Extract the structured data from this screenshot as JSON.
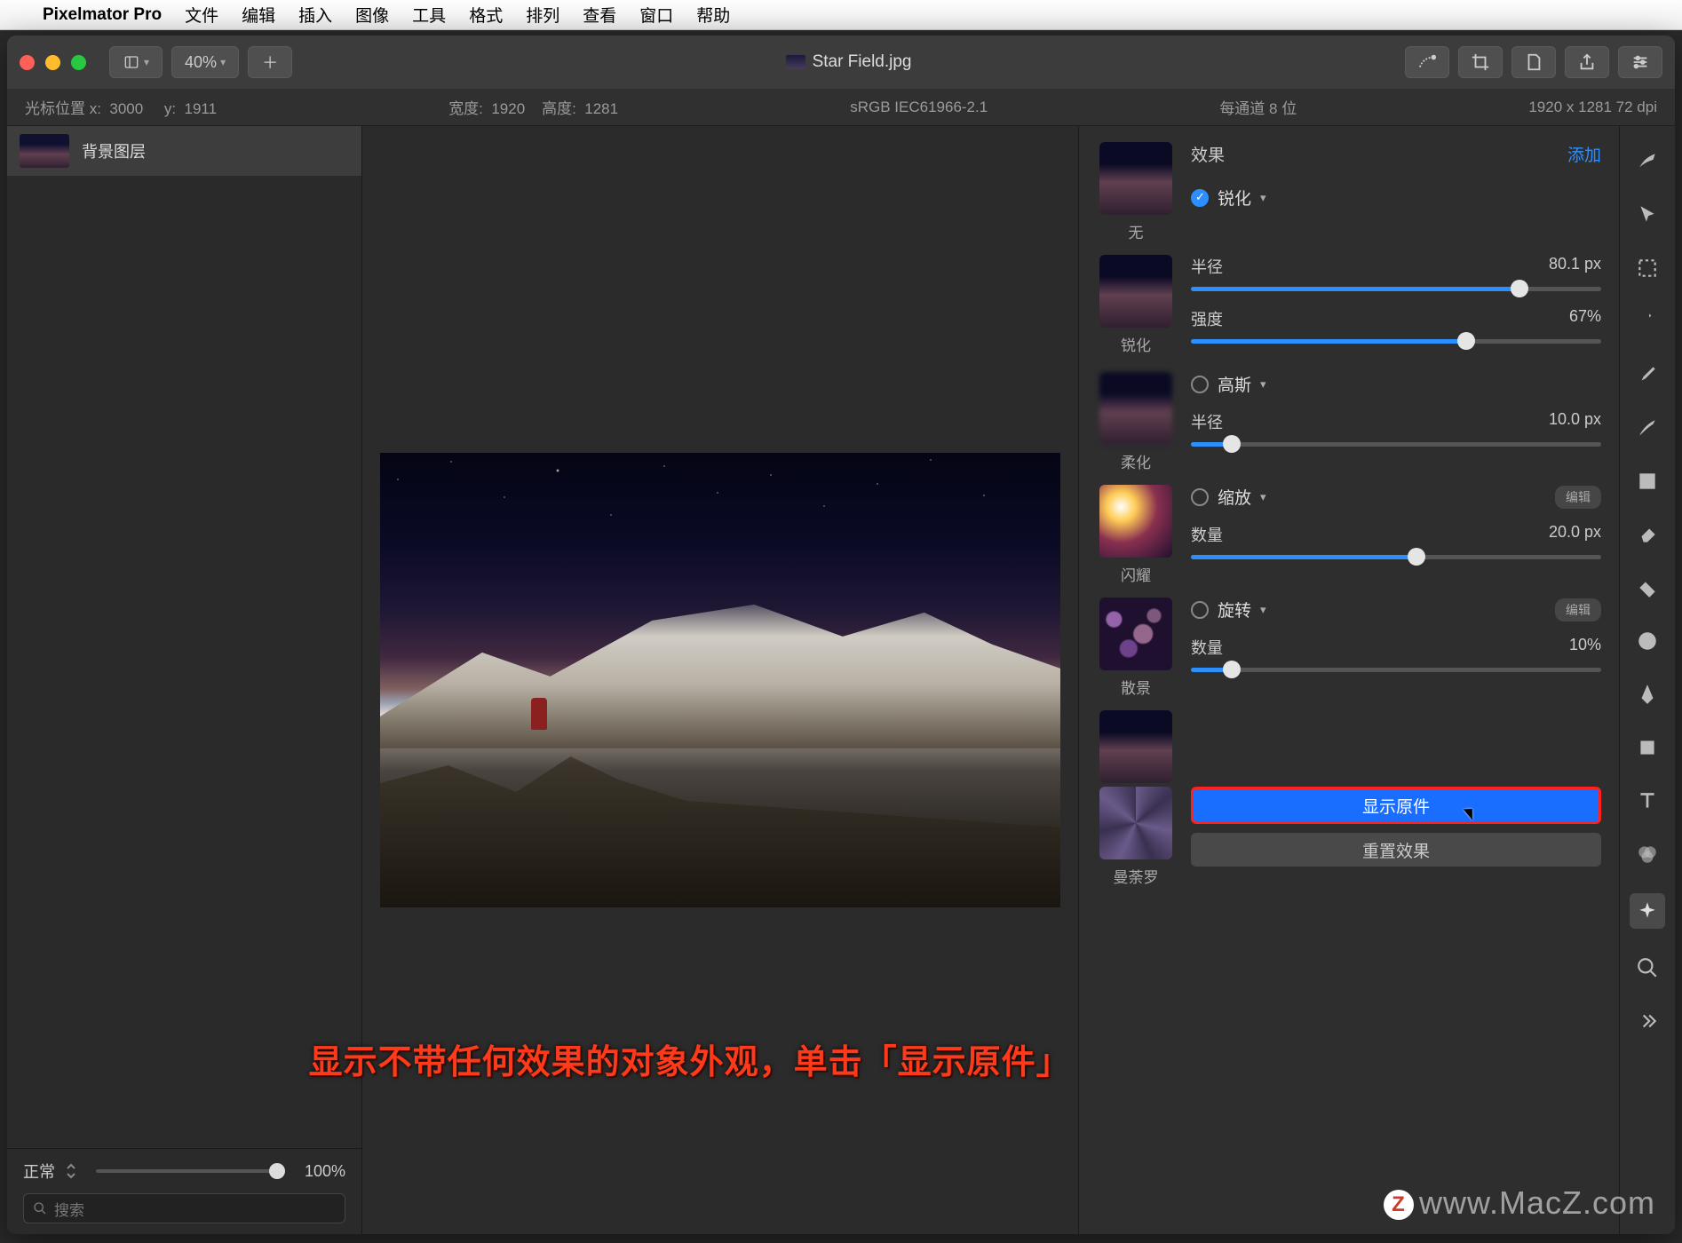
{
  "menubar": {
    "app": "Pixelmator Pro",
    "items": [
      "文件",
      "编辑",
      "插入",
      "图像",
      "工具",
      "格式",
      "排列",
      "查看",
      "窗口",
      "帮助"
    ]
  },
  "toolbar": {
    "zoom": "40%",
    "filename": "Star Field.jpg"
  },
  "infobar": {
    "cursor_label": "光标位置 x:  3000     y:  1911",
    "width": "宽度:  1920",
    "height": "高度:  1281",
    "profile": "sRGB IEC61966-2.1",
    "depth": "每通道 8 位",
    "dims": "1920 x 1281 72 dpi"
  },
  "layers": {
    "item0": "背景图层",
    "blend_mode": "正常",
    "opacity": "100%",
    "search_placeholder": "搜索"
  },
  "effects": {
    "title": "效果",
    "add": "添加",
    "presets": {
      "none": "无",
      "sharpen": "锐化",
      "soften": "柔化",
      "flash": "闪耀",
      "bokeh": "散景",
      "kaleido": "曼荼罗"
    },
    "sharpen": {
      "name": "锐化",
      "radius_label": "半径",
      "radius_value": "80.1 px",
      "intensity_label": "强度",
      "intensity_value": "67%"
    },
    "gauss": {
      "name": "高斯",
      "radius_label": "半径",
      "radius_value": "10.0 px"
    },
    "zoom": {
      "name": "缩放",
      "edit": "编辑",
      "amount_label": "数量",
      "amount_value": "20.0 px"
    },
    "spin": {
      "name": "旋转",
      "edit": "编辑",
      "amount_label": "数量",
      "amount_value": "10%"
    },
    "show_original": "显示原件",
    "reset": "重置效果"
  },
  "overlay": "显示不带任何效果的对象外观，单击「显示原件」",
  "watermark": "www.MacZ.com"
}
